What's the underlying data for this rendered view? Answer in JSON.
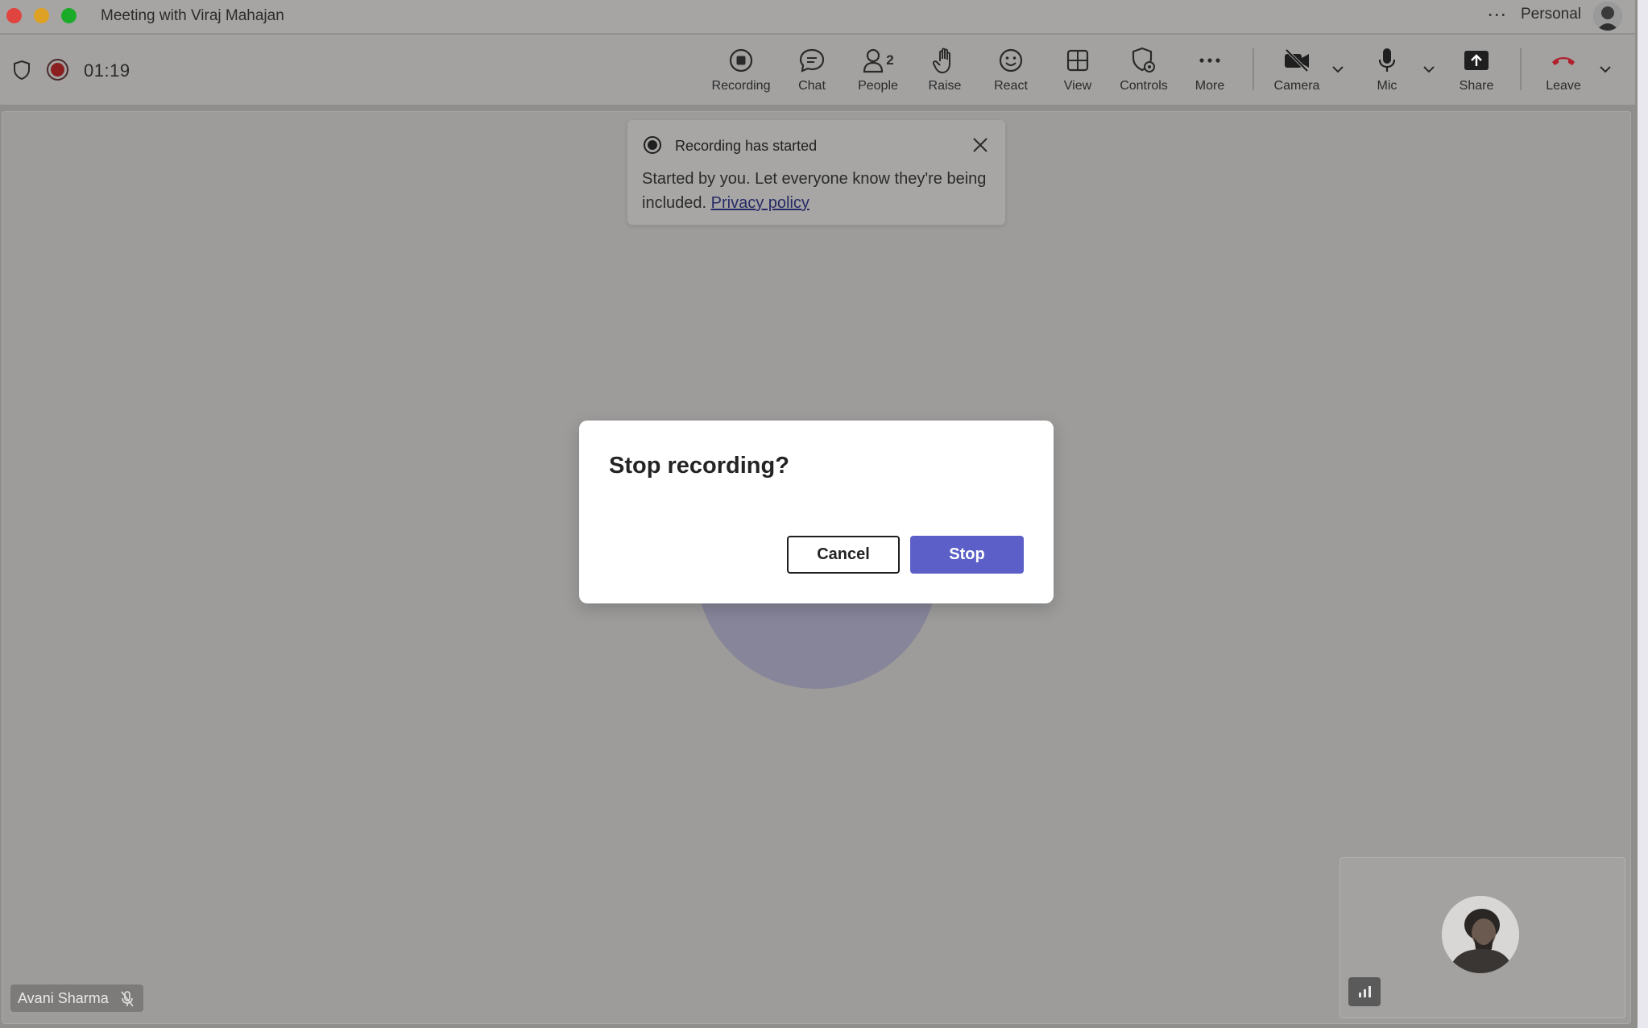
{
  "window": {
    "title": "Meeting with Viraj Mahajan",
    "menu_dots": "⋯",
    "account_label": "Personal"
  },
  "toolbar": {
    "timer": "01:19",
    "tools": [
      {
        "label": "Recording",
        "icon": "record-icon"
      },
      {
        "label": "Chat",
        "icon": "chat-icon"
      },
      {
        "label": "People",
        "icon": "people-icon",
        "count": "2"
      },
      {
        "label": "Raise",
        "icon": "hand-icon"
      },
      {
        "label": "React",
        "icon": "smiley-icon"
      },
      {
        "label": "View",
        "icon": "grid-icon"
      },
      {
        "label": "Controls",
        "icon": "shield-gear-icon"
      },
      {
        "label": "More",
        "icon": "more-icon"
      },
      {
        "label": "Camera",
        "icon": "camera-off-icon"
      },
      {
        "label": "Mic",
        "icon": "mic-icon"
      },
      {
        "label": "Share",
        "icon": "share-icon"
      },
      {
        "label": "Leave",
        "icon": "phone-hangup-icon"
      }
    ]
  },
  "toast": {
    "title": "Recording has started",
    "body": "Started by you. Let everyone know they're being included.",
    "link": "Privacy policy"
  },
  "dialog": {
    "title": "Stop recording?",
    "cancel_label": "Cancel",
    "stop_label": "Stop"
  },
  "participant": {
    "name": "Avani Sharma"
  },
  "colors": {
    "stop_button": "#5b5fc7",
    "record_red": "#8b1f1f",
    "leave_red": "#c4314b"
  }
}
